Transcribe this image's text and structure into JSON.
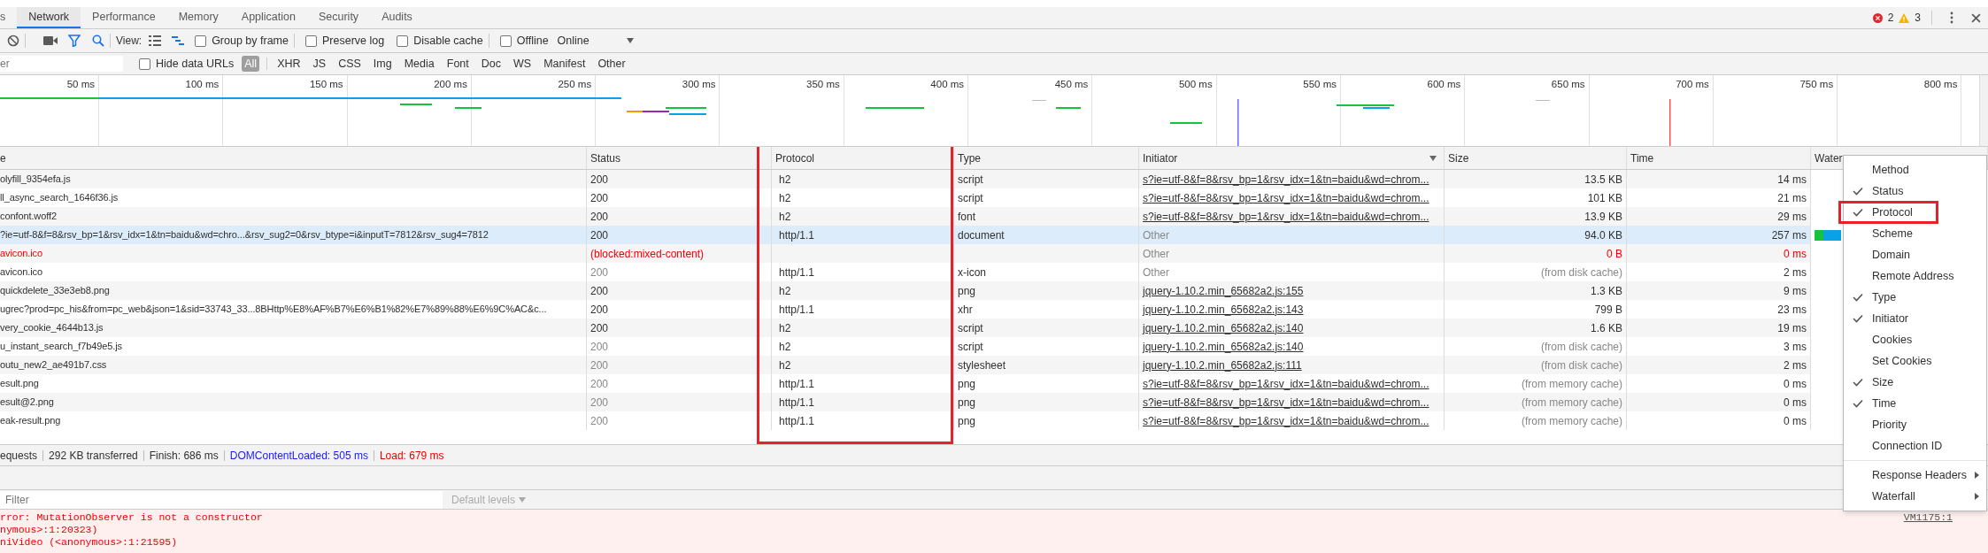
{
  "tabs": [
    {
      "label": "s",
      "selected": false
    },
    {
      "label": "Network",
      "selected": true
    },
    {
      "label": "Performance",
      "selected": false
    },
    {
      "label": "Memory",
      "selected": false
    },
    {
      "label": "Application",
      "selected": false
    },
    {
      "label": "Security",
      "selected": false
    },
    {
      "label": "Audits",
      "selected": false
    }
  ],
  "counters": {
    "errors": "2",
    "warnings": "3"
  },
  "toolbar": {
    "view_label": "View:",
    "large_rows": false,
    "overview": true,
    "checkboxes": [
      {
        "label": "Group by frame",
        "checked": false
      },
      {
        "label": "Preserve log",
        "checked": false
      },
      {
        "label": "Disable cache",
        "checked": false
      },
      {
        "label": "Offline",
        "checked": false
      }
    ],
    "throttling": "Online"
  },
  "filter_bar": {
    "placeholder": "er",
    "hide_data_urls": {
      "label": "Hide data URLs",
      "checked": false
    },
    "types": [
      {
        "label": "All",
        "selected": true
      },
      {
        "label": "XHR",
        "selected": false
      },
      {
        "label": "JS",
        "selected": false
      },
      {
        "label": "CSS",
        "selected": false
      },
      {
        "label": "Img",
        "selected": false
      },
      {
        "label": "Media",
        "selected": false
      },
      {
        "label": "Font",
        "selected": false
      },
      {
        "label": "Doc",
        "selected": false
      },
      {
        "label": "WS",
        "selected": false
      },
      {
        "label": "Manifest",
        "selected": false
      },
      {
        "label": "Other",
        "selected": false
      }
    ]
  },
  "overview": {
    "ticks": [
      "50 ms",
      "100 ms",
      "150 ms",
      "200 ms",
      "250 ms",
      "300 ms",
      "350 ms",
      "400 ms",
      "450 ms",
      "500 ms",
      "550 ms",
      "600 ms",
      "650 ms",
      "700 ms",
      "750 ms",
      "800 ms"
    ]
  },
  "table": {
    "columns": [
      "e",
      "Status",
      "Protocol",
      "Type",
      "Initiator",
      "Size",
      "Time",
      "Water"
    ],
    "rows": [
      {
        "name": "olyfill_9354efa.js",
        "status": "200",
        "protocol": "h2",
        "type": "script",
        "initiator": "s?ie=utf-8&f=8&rsv_bp=1&rsv_idx=1&tn=baidu&wd=chrom...",
        "initiator_link": true,
        "size": "13.5 KB",
        "time": "14 ms",
        "cached": false,
        "failed": false,
        "selected": false
      },
      {
        "name": "ll_async_search_1646f36.js",
        "status": "200",
        "protocol": "h2",
        "type": "script",
        "initiator": "s?ie=utf-8&f=8&rsv_bp=1&rsv_idx=1&tn=baidu&wd=chrom...",
        "initiator_link": true,
        "size": "101 KB",
        "time": "21 ms",
        "cached": false,
        "failed": false,
        "selected": false
      },
      {
        "name": "confont.woff2",
        "status": "200",
        "protocol": "h2",
        "type": "font",
        "initiator": "s?ie=utf-8&f=8&rsv_bp=1&rsv_idx=1&tn=baidu&wd=chrom...",
        "initiator_link": true,
        "size": "13.9 KB",
        "time": "29 ms",
        "cached": false,
        "failed": false,
        "selected": false
      },
      {
        "name": "?ie=utf-8&f=8&rsv_bp=1&rsv_idx=1&tn=baidu&wd=chro...&rsv_sug2=0&rsv_btype=i&inputT=7812&rsv_sug4=7812",
        "status": "200",
        "protocol": "http/1.1",
        "type": "document",
        "initiator": "Other",
        "initiator_link": false,
        "size": "94.0 KB",
        "time": "257 ms",
        "cached": false,
        "failed": false,
        "selected": true
      },
      {
        "name": "avicon.ico",
        "status": "(blocked:mixed-content)",
        "type": "",
        "initiator": "Other",
        "initiator_link": false,
        "size": "0 B",
        "time": "0 ms",
        "cached": false,
        "failed": true,
        "selected": false
      },
      {
        "name": "avicon.ico",
        "status": "200",
        "protocol": "http/1.1",
        "type": "x-icon",
        "initiator": "Other",
        "initiator_link": false,
        "size": "(from disk cache)",
        "time": "2 ms",
        "cached": true,
        "failed": false,
        "selected": false
      },
      {
        "name": "quickdelete_33e3eb8.png",
        "status": "200",
        "protocol": "h2",
        "type": "png",
        "initiator": "jquery-1.10.2.min_65682a2.js:155",
        "initiator_link": true,
        "size": "1.3 KB",
        "time": "9 ms",
        "cached": false,
        "failed": false,
        "selected": false
      },
      {
        "name": "ugrec?prod=pc_his&from=pc_web&json=1&sid=33743_33...8BHttp%E8%AF%B7%E6%B1%82%E7%89%88%E6%9C%AC&c...",
        "status": "200",
        "protocol": "http/1.1",
        "type": "xhr",
        "initiator": "jquery-1.10.2.min_65682a2.js:143",
        "initiator_link": true,
        "size": "799 B",
        "time": "23 ms",
        "cached": false,
        "failed": false,
        "selected": false
      },
      {
        "name": "very_cookie_4644b13.js",
        "status": "200",
        "protocol": "h2",
        "type": "script",
        "initiator": "jquery-1.10.2.min_65682a2.js:140",
        "initiator_link": true,
        "size": "1.6 KB",
        "time": "19 ms",
        "cached": false,
        "failed": false,
        "selected": false
      },
      {
        "name": "u_instant_search_f7b49e5.js",
        "status": "200",
        "protocol": "h2",
        "type": "script",
        "initiator": "jquery-1.10.2.min_65682a2.js:140",
        "initiator_link": true,
        "size": "(from disk cache)",
        "time": "3 ms",
        "cached": true,
        "failed": false,
        "selected": false
      },
      {
        "name": "outu_new2_ae491b7.css",
        "status": "200",
        "protocol": "h2",
        "type": "stylesheet",
        "initiator": "jquery-1.10.2.min_65682a2.js:111",
        "initiator_link": true,
        "size": "(from disk cache)",
        "time": "2 ms",
        "cached": true,
        "failed": false,
        "selected": false
      },
      {
        "name": "esult.png",
        "status": "200",
        "protocol": "http/1.1",
        "type": "png",
        "initiator": "s?ie=utf-8&f=8&rsv_bp=1&rsv_idx=1&tn=baidu&wd=chrom...",
        "initiator_link": true,
        "size": "(from memory cache)",
        "time": "0 ms",
        "cached": true,
        "failed": false,
        "selected": false
      },
      {
        "name": "esult@2.png",
        "status": "200",
        "protocol": "http/1.1",
        "type": "png",
        "initiator": "s?ie=utf-8&f=8&rsv_bp=1&rsv_idx=1&tn=baidu&wd=chrom...",
        "initiator_link": true,
        "size": "(from memory cache)",
        "time": "0 ms",
        "cached": true,
        "failed": false,
        "selected": false
      },
      {
        "name": "eak-result.png",
        "status": "200",
        "protocol": "http/1.1",
        "type": "png",
        "initiator": "s?ie=utf-8&f=8&rsv_bp=1&rsv_idx=1&tn=baidu&wd=chrom...",
        "initiator_link": true,
        "size": "(from memory cache)",
        "time": "0 ms",
        "cached": true,
        "failed": false,
        "selected": false
      }
    ]
  },
  "summary": [
    {
      "text": "equests",
      "kind": "plain"
    },
    {
      "text": "292 KB transferred",
      "kind": "plain"
    },
    {
      "text": "Finish: 686 ms",
      "kind": "plain"
    },
    {
      "text": "DOMContentLoaded: 505 ms",
      "kind": "dom"
    },
    {
      "text": "Load: 679 ms",
      "kind": "load"
    }
  ],
  "console": {
    "placeholder": "Filter",
    "levels": "Default levels",
    "messages": [
      "rror: MutationObserver is not a constructor",
      "nymous>:1:20323)",
      "niVideo (<anonymous>:1:21595)"
    ],
    "source": "VM1175:1"
  },
  "context_menu": {
    "items": [
      {
        "label": "Method",
        "checked": false,
        "kind": "item"
      },
      {
        "label": "Status",
        "checked": true,
        "kind": "item"
      },
      {
        "label": "Protocol",
        "checked": true,
        "kind": "item"
      },
      {
        "label": "Scheme",
        "checked": false,
        "kind": "item"
      },
      {
        "label": "Domain",
        "checked": false,
        "kind": "item"
      },
      {
        "label": "Remote Address",
        "checked": false,
        "kind": "item"
      },
      {
        "label": "Type",
        "checked": true,
        "kind": "item"
      },
      {
        "label": "Initiator",
        "checked": true,
        "kind": "item"
      },
      {
        "label": "Cookies",
        "checked": false,
        "kind": "item"
      },
      {
        "label": "Set Cookies",
        "checked": false,
        "kind": "item"
      },
      {
        "label": "Size",
        "checked": true,
        "kind": "item"
      },
      {
        "label": "Time",
        "checked": true,
        "kind": "item"
      },
      {
        "label": "Priority",
        "checked": false,
        "kind": "item"
      },
      {
        "label": "Connection ID",
        "checked": false,
        "kind": "item"
      },
      {
        "kind": "separator"
      },
      {
        "label": "Response Headers",
        "kind": "submenu"
      },
      {
        "label": "Waterfall",
        "kind": "submenu"
      }
    ]
  }
}
